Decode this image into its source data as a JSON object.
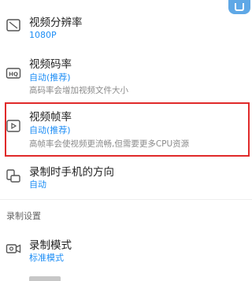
{
  "settings": {
    "resolution": {
      "title": "视频分辨率",
      "value": "1080P",
      "icon": "crop-icon"
    },
    "bitrate": {
      "title": "视频码率",
      "value": "自动(推荐)",
      "desc": "高码率会增加视频文件大小",
      "icon": "hq-icon"
    },
    "framerate": {
      "title": "视频帧率",
      "value": "自动(推荐)",
      "desc": "高帧率会使视频更流畅,但需要更多CPU资源",
      "icon": "play-frame-icon"
    },
    "orientation": {
      "title": "录制时手机的方向",
      "value": "自动",
      "icon": "rotate-icon"
    }
  },
  "section": {
    "title": "录制设置"
  },
  "record": {
    "mode": {
      "title": "录制模式",
      "value": "标准模式",
      "icon": "camera-icon"
    }
  },
  "colors": {
    "accent": "#1c8df5",
    "highlight": "#e02a2a"
  }
}
